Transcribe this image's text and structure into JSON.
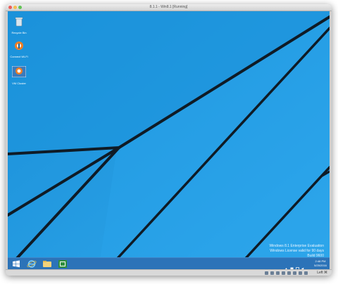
{
  "window": {
    "title": "8.1.1 - Win8.1 [Running]"
  },
  "desktop": {
    "icons": [
      {
        "name": "recycle-bin-icon",
        "label": "Recycle Bin"
      },
      {
        "name": "app-shortcut-icon",
        "label": "Connect Wi-Fi"
      },
      {
        "name": "app-shortcut-icon",
        "label": "VM Cluster"
      }
    ]
  },
  "watermark": {
    "line1": "Windows 8.1 Enterprise Evaluation",
    "line2": "Windows License valid for 90 days",
    "line3": "Build 9600"
  },
  "taskbar": {
    "buttons": [
      {
        "name": "start-button",
        "icon": "windows-logo-icon"
      },
      {
        "name": "internet-explorer-button",
        "icon": "internet-explorer-icon"
      },
      {
        "name": "file-explorer-button",
        "icon": "folder-icon"
      },
      {
        "name": "store-button",
        "icon": "store-icon"
      }
    ],
    "clock_time": "2:48 PM",
    "clock_date": "5/25/2016"
  },
  "statusbar": {
    "host_key": "Left ⌘"
  },
  "colors": {
    "wallpaper": "#1f9ae0",
    "taskbar": "#2c73b8",
    "streak": "#0e1a24"
  }
}
